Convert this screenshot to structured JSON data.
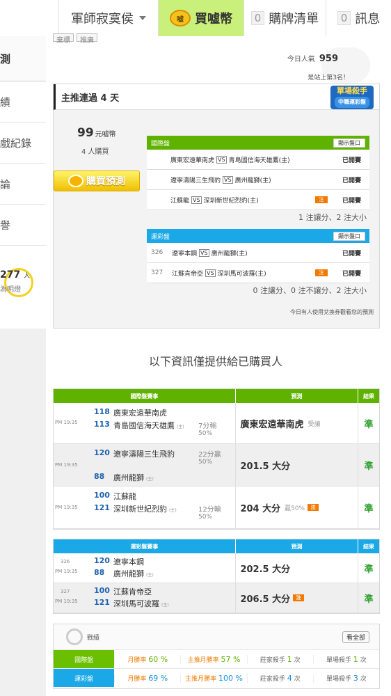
{
  "topbar": {
    "user_name": "軍師寂寞侯",
    "buy_coins": "買嘘幣",
    "coin_icon_label": "嘘",
    "cart_count": "0",
    "cart_label": "購牌清單",
    "msg_count": "0",
    "msg_label": "訊息"
  },
  "sidebar": {
    "items": [
      "測",
      "績",
      "戲紀錄",
      "論",
      "譽"
    ],
    "popular_num": "277",
    "popular_unit": "人",
    "popular_sub": "為明燈"
  },
  "header": {
    "crumbs": [
      "棄標",
      "推廣"
    ],
    "hot_label": "今日人氣",
    "hot_value": "959",
    "rank_text": "是站上第3名！"
  },
  "streak_card": {
    "title": "主推連過 4 天",
    "badge_main": "單場殺手",
    "badge_sub": "中職運彩盤",
    "price": "99",
    "price_unit": "元嘘幣",
    "buyers": "4 人購買",
    "buy_button": "購買預測",
    "intl_title": "國際盤",
    "show_btn": "顯示盤口",
    "intl_rows": [
      {
        "home": "廣東宏遠華南虎",
        "away": "青島國信海天雄鷹(主)",
        "status": "已開賽",
        "bet": false
      },
      {
        "home": "遼寧濤陽三生飛豹",
        "away": "廣州龍獅(主)",
        "status": "已開賽",
        "bet": false
      },
      {
        "home": "江蘇龍",
        "away": "深圳新世紀烈豹(主)",
        "status": "已開賽",
        "bet": true
      }
    ],
    "intl_summary": "1 注讓分、2 注大小",
    "lottery_title": "運彩盤",
    "lottery_rows": [
      {
        "num": "326",
        "home": "遼寧本鋼",
        "away": "廣州龍獅(主)",
        "status": "已開賽",
        "bet": false
      },
      {
        "num": "327",
        "home": "江蘇肯帝亞",
        "away": "深圳馬可波羅(主)",
        "status": "已開賽",
        "bet": true
      }
    ],
    "lottery_summary": "0 注讓分、0 注不讓分、2 注大小",
    "note": "今日有人使用兌換券觀看您的預測",
    "vs_label": "VS",
    "bet_label": "注"
  },
  "info_title": "以下資訊僅提供給已購買人",
  "intl_pred": {
    "h1": "國際盤賽事",
    "h2": "預測",
    "h3": "結果",
    "rows": [
      {
        "time": "PM 19:35",
        "n1": "118",
        "t1": "廣東宏遠華南虎",
        "n2": "113",
        "t2": "青島國信海天雄鷹",
        "side1": "7分輸",
        "side2": "50%",
        "pred": "廣東宏遠華南虎",
        "pred_sub": "受讓",
        "result": "準"
      },
      {
        "time": "PM 19:35",
        "n1": "120",
        "t1": "遼寧濤陽三生飛豹",
        "n2": "88",
        "t2": "廣州龍獅",
        "side1": "22分贏",
        "side2": "50%",
        "pred": "201.5 大分",
        "pred_sub": "",
        "result": "準"
      },
      {
        "time": "PM 19:35",
        "n1": "100",
        "t1": "江蘇龍",
        "n2": "121",
        "t2": "深圳新世紀烈豹",
        "side1": "12分輸",
        "side2": "50%",
        "pred": "204 大分",
        "pred_sub": "贏50%",
        "result": "準"
      }
    ]
  },
  "lottery_pred": {
    "h1": "運彩盤賽事",
    "h2": "預測",
    "h3": "結果",
    "rows": [
      {
        "num": "326",
        "time": "PM 19:35",
        "n1": "120",
        "t1": "遼寧本鋼",
        "n2": "88",
        "t2": "廣州龍獅",
        "pred": "202.5 大分",
        "result": "準"
      },
      {
        "num": "327",
        "time": "PM 19:35",
        "n1": "100",
        "t1": "江蘇肯帝亞",
        "n2": "121",
        "t2": "深圳馬可波羅",
        "pred": "206.5 大分",
        "result": "準"
      }
    ]
  },
  "record": {
    "title": "戰績",
    "see_all": "看全部",
    "rows": [
      {
        "label": "國際盤",
        "win_label": "月勝率",
        "win": "60 %",
        "main_label": "主推月勝率",
        "main": "57 %",
        "banker_label": "莊家殺手",
        "banker": "1",
        "single_label": "單場殺手",
        "single": "1",
        "unit": "次"
      },
      {
        "label": "運彩盤",
        "win_label": "月勝率",
        "win": "69 %",
        "main_label": "主推月勝率",
        "main": "100 %",
        "banker_label": "莊家殺手",
        "banker": "4",
        "single_label": "單場殺手",
        "single": "3",
        "unit": "次"
      }
    ]
  },
  "host_label": "(主)"
}
